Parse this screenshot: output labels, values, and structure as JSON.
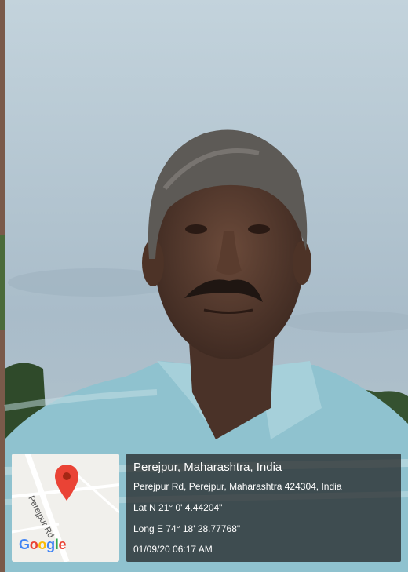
{
  "map": {
    "street": "Perejpur Rd",
    "brand_letters": [
      {
        "ch": "G",
        "color": "#4285F4"
      },
      {
        "ch": "o",
        "color": "#EA4335"
      },
      {
        "ch": "o",
        "color": "#FBBC05"
      },
      {
        "ch": "g",
        "color": "#4285F4"
      },
      {
        "ch": "l",
        "color": "#34A853"
      },
      {
        "ch": "e",
        "color": "#EA4335"
      }
    ],
    "pin_color": "#EA4335"
  },
  "info": {
    "place": "Perejpur, Maharashtra, India",
    "address": "Perejpur Rd, Perejpur, Maharashtra 424304, India",
    "latitude": "Lat N 21° 0' 4.44204\"",
    "longitude": "Long E 74° 18' 28.77768\"",
    "datetime": "01/09/20 06:17 AM"
  },
  "colors": {
    "sky": "#b4c8d4",
    "shirt": "#8fc2cf"
  }
}
